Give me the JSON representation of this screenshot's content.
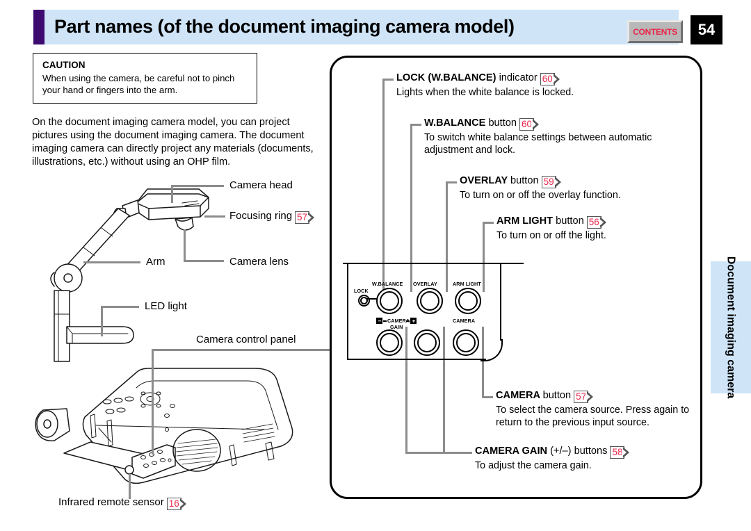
{
  "header": {
    "title": "Part names (of the document imaging camera model)",
    "contents_label": "CONTENTS",
    "page_number": "54"
  },
  "caution": {
    "title": "CAUTION",
    "body": "When using the camera, be careful not to pinch your hand or fingers into the arm."
  },
  "intro": "On the document imaging camera model, you can project pictures using the document imaging camera. The document imaging camera can directly project any materials (documents, illustrations, etc.) without using an OHP film.",
  "left_labels": {
    "camera_head": "Camera head",
    "focusing_ring": "Focusing ring",
    "focusing_ring_ref": "57",
    "arm": "Arm",
    "camera_lens": "Camera lens",
    "led_light": "LED light",
    "camera_control_panel": "Camera control panel",
    "infrared_remote_sensor": "Infrared remote sensor",
    "infrared_remote_sensor_ref": "16"
  },
  "callouts": [
    {
      "name": "lock-wbalance-indicator",
      "title_bold": "LOCK (W.BALANCE)",
      "title_rest": "indicator",
      "ref": "60",
      "desc": "Lights when the white balance is locked."
    },
    {
      "name": "wbalance-button",
      "title_bold": "W.BALANCE",
      "title_rest": "button",
      "ref": "60",
      "desc": "To switch white balance settings between automatic adjustment and lock."
    },
    {
      "name": "overlay-button",
      "title_bold": "OVERLAY",
      "title_rest": "button",
      "ref": "59",
      "desc": "To turn on or off the overlay function."
    },
    {
      "name": "arm-light-button",
      "title_bold": "ARM LIGHT",
      "title_rest": "button",
      "ref": "56",
      "desc": "To turn on or off the light."
    },
    {
      "name": "camera-button",
      "title_bold": "CAMERA",
      "title_rest": "button",
      "ref": "57",
      "desc": "To select the camera source. Press again to return to the previous input source."
    },
    {
      "name": "camera-gain-buttons",
      "title_bold": "CAMERA GAIN",
      "title_rest": "(+/–) buttons",
      "ref": "58",
      "desc": "To adjust the camera gain."
    }
  ],
  "control_panel": {
    "lock_label": "LOCK",
    "wbalance_label": "W.BALANCE",
    "overlay_label": "OVERLAY",
    "arm_light_label": "ARM LIGHT",
    "camera_gain_label": "CAMERA",
    "gain_label": "GAIN",
    "camera_label": "CAMERA"
  },
  "side_tab": "Document\nimaging camera",
  "colors": {
    "header_bg": "#cfe4f7",
    "accent_purple": "#3d0b70",
    "ref_red": "#e8264a",
    "leader_gray": "#8c8c8c"
  }
}
